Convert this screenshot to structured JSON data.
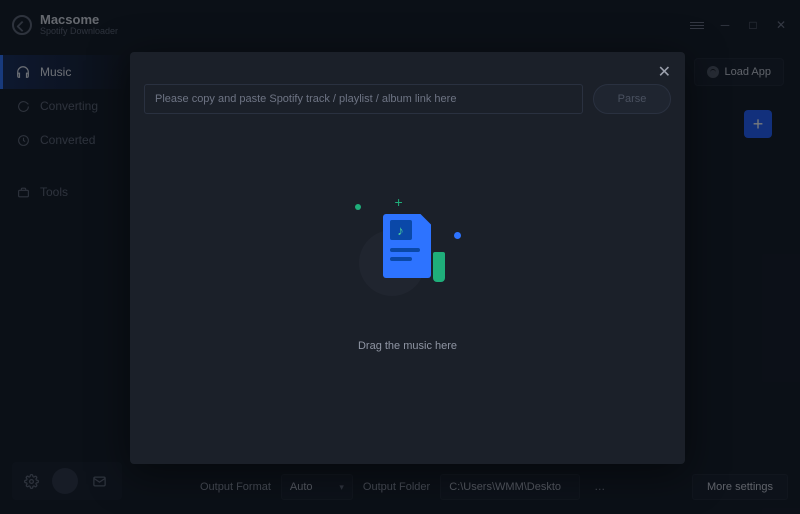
{
  "brand": {
    "title": "Macsome",
    "subtitle": "Spotify Downloader"
  },
  "sidebar": {
    "items": [
      {
        "label": "Music"
      },
      {
        "label": "Converting"
      },
      {
        "label": "Converted"
      },
      {
        "label": "Tools"
      }
    ]
  },
  "loadapp_label": "Load App",
  "modal": {
    "url_placeholder": "Please copy and paste Spotify track / playlist / album link here",
    "parse_label": "Parse",
    "drag_text": "Drag the music here"
  },
  "footer": {
    "format_label": "Output Format",
    "format_value": "Auto",
    "folder_label": "Output Folder",
    "folder_value": "C:\\Users\\WMM\\Deskto",
    "more_label": "More settings"
  }
}
